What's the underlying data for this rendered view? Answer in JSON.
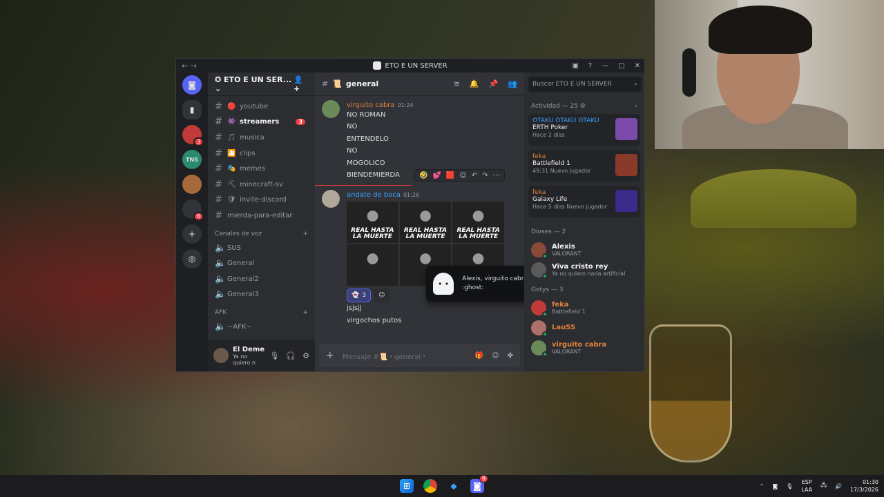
{
  "window": {
    "title": "ETO E UN SERVER"
  },
  "server": {
    "name": "ETO E UN SER..."
  },
  "rail": [
    {
      "name": "discord-home",
      "glyph": "◙"
    },
    {
      "name": "dm",
      "glyph": "▮"
    },
    {
      "name": "server-1",
      "badge": "3"
    },
    {
      "name": "server-tns",
      "glyph": "TNS"
    },
    {
      "name": "server-3",
      "glyph": ""
    },
    {
      "name": "server-folder",
      "badge": "6"
    }
  ],
  "channels": [
    {
      "name": "youtube",
      "emoji": "🔴",
      "style": "normal"
    },
    {
      "name": "streamers",
      "emoji": "👾",
      "style": "bold",
      "count": "3"
    },
    {
      "name": "musica",
      "emoji": "🎵",
      "style": "normal"
    },
    {
      "name": "clips",
      "emoji": "🎦",
      "style": "normal"
    },
    {
      "name": "memes",
      "emoji": "🎭",
      "style": "normal"
    },
    {
      "name": "minecraft-sv",
      "emoji": "⛏",
      "style": "normal"
    },
    {
      "name": "invite-discord",
      "emoji": "🛡",
      "style": "normal"
    },
    {
      "name": "mierda-para-editar",
      "emoji": "",
      "style": "normal"
    }
  ],
  "voice": {
    "label": "Canales de voz",
    "items": [
      "SUS",
      "General",
      "General2",
      "General3"
    ]
  },
  "afk": {
    "label": "AFK",
    "items": [
      "~AFK~"
    ]
  },
  "user": {
    "name": "El Deme",
    "status": "Ya no quiero n"
  },
  "channel": {
    "name": "general",
    "composer_placeholder": "Mensaje #📜・general・"
  },
  "messages": [
    {
      "author": "virguito cabra",
      "color": "#e0803c",
      "time": "01:24",
      "lines": [
        "NO ROMAN",
        "NO",
        "ENTENDELO",
        "NO",
        "MOGOLICO",
        "BIENDEMIERDA"
      ]
    },
    {
      "author": "andate de boca",
      "color": "#3ba0ff",
      "time": "01:26",
      "image_caption": "REAL HASTA LA MUERTE",
      "reaction_count": "3",
      "after": [
        "jsjsjj",
        "virgochos putos"
      ]
    }
  ],
  "tooltip": {
    "text": "Alexis, virguito cabra y Viva cristo rey reaccionaron con :ghost:"
  },
  "search": {
    "placeholder": "Buscar ETO E UN SERVER"
  },
  "activity": {
    "header": "Actividad — 25 ⚙",
    "cards": [
      {
        "user": "OTAKU OTAKU OTAKU",
        "user_color": "#3ba0ff",
        "title": "ERTH Poker",
        "sub": "Hace 2 días",
        "thumb": "#7a4aa8"
      },
      {
        "user": "feka",
        "user_color": "#e0803c",
        "title": "Battlefield 1",
        "sub": "49:31   Nuevo jugador",
        "thumb": "#8a3a2a"
      },
      {
        "user": "feka",
        "user_color": "#e0803c",
        "title": "Galaxy Life",
        "sub": "Hace 5 días   Nuevo jugador",
        "thumb": "#3a2a8a"
      }
    ]
  },
  "members": [
    {
      "group": "Dioses — 2",
      "items": [
        {
          "name": "Alexis",
          "status": "VALORANT",
          "color": "#f2f3f5",
          "av": "#8a4a3a"
        },
        {
          "name": "Viva cristo rey",
          "status": "Ya no quiero nada artificial",
          "color": "#f2f3f5",
          "av": "#5a5a5a"
        }
      ]
    },
    {
      "group": "Gotys — 3",
      "items": [
        {
          "name": "feka",
          "status": "Battlefield 1",
          "color": "#e0803c",
          "av": "#c03a3a"
        },
        {
          "name": "LauSS",
          "status": "",
          "color": "#e0803c",
          "av": "#b0706a"
        },
        {
          "name": "virguito cabra",
          "status": "VALORANT",
          "color": "#e0803c",
          "av": "#6a8a5a"
        }
      ]
    }
  ],
  "taskbar": {
    "lang": "ESP",
    "lang2": "LAA",
    "time": "01:30",
    "date": "17/3/2026",
    "discord_badge": "9"
  }
}
